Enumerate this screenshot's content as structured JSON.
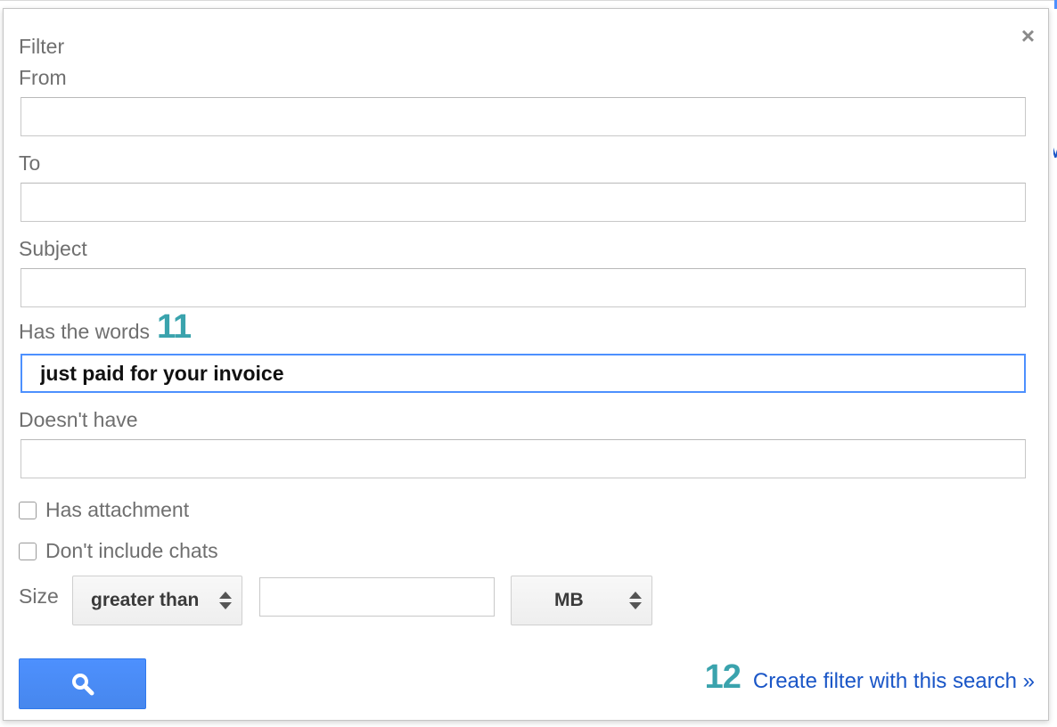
{
  "dialog": {
    "title": "Filter",
    "close_label": "×"
  },
  "fields": {
    "from": {
      "label": "From",
      "value": ""
    },
    "to": {
      "label": "To",
      "value": ""
    },
    "subject": {
      "label": "Subject",
      "value": ""
    },
    "has_words": {
      "label": "Has the words",
      "value": "just paid for your invoice"
    },
    "doesnt_have": {
      "label": "Doesn't have",
      "value": ""
    }
  },
  "annotations": {
    "step_has_words": "11",
    "step_create_filter": "12"
  },
  "checkboxes": {
    "has_attachment": {
      "label": "Has attachment",
      "checked": false
    },
    "dont_include_chats": {
      "label": "Don't include chats",
      "checked": false
    }
  },
  "size": {
    "label": "Size",
    "comparator": "greater than",
    "value": "",
    "unit": "MB"
  },
  "actions": {
    "search_icon": "search-icon",
    "create_filter_label": "Create filter with this search »"
  },
  "colors": {
    "accent_blue": "#4d90fe",
    "link_blue": "#1a56c7",
    "annotation_teal": "#3aa3ad"
  }
}
